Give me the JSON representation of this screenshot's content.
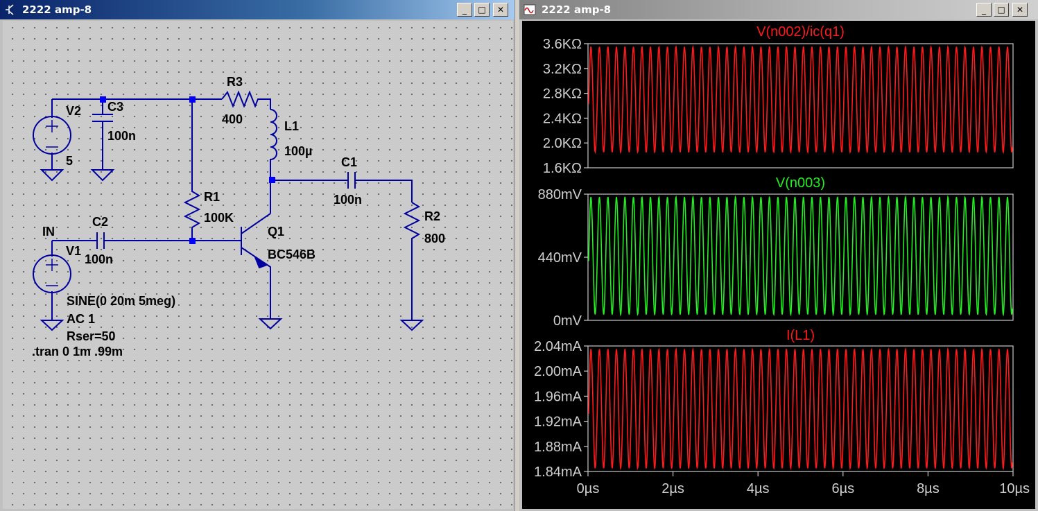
{
  "left_window": {
    "title": "2222 amp-8"
  },
  "right_window": {
    "title": "2222 amp-8"
  },
  "window_buttons": {
    "minimize": "_",
    "maximize": "□",
    "close": "✕"
  },
  "schematic": {
    "labels": {
      "v2_name": "V2",
      "v2_value": "5",
      "c3_name": "C3",
      "c3_value": "100n",
      "r3_name": "R3",
      "r3_value": "400",
      "l1_name": "L1",
      "l1_value": "100µ",
      "c1_name": "C1",
      "c1_value": "100n",
      "r1_name": "R1",
      "r1_value": "100K",
      "q1_name": "Q1",
      "q1_value": "BC546B",
      "r2_name": "R2",
      "r2_value": "800",
      "in_label": "IN",
      "c2_name": "C2",
      "c2_value": "100n",
      "v1_name": "V1",
      "v1_sine": "SINE(0 20m 5meg)",
      "v1_ac": "AC 1",
      "v1_rser": "Rser=50",
      "tran_directive": ".tran 0 1m .99m"
    }
  },
  "chart_data": [
    {
      "type": "line",
      "title": "V(n002)/ic(q1)",
      "color": "#ff1a1a",
      "y_ticks": [
        "3.6KΩ",
        "3.2KΩ",
        "2.8KΩ",
        "2.4KΩ",
        "2.0KΩ",
        "1.6KΩ"
      ],
      "ylim": [
        1600,
        3600
      ],
      "wave": {
        "min": 1850,
        "max": 3550,
        "period_us": 0.2
      },
      "xlim": [
        0,
        10
      ]
    },
    {
      "type": "line",
      "title": "V(n003)",
      "color": "#22ee22",
      "y_ticks": [
        "880mV",
        "440mV",
        "0mV"
      ],
      "ylim": [
        0,
        880
      ],
      "wave": {
        "min": 40,
        "max": 860,
        "period_us": 0.2
      },
      "xlim": [
        0,
        10
      ]
    },
    {
      "type": "line",
      "title": "I(L1)",
      "color": "#ff1a1a",
      "y_ticks": [
        "2.04mA",
        "2.00mA",
        "1.96mA",
        "1.92mA",
        "1.88mA",
        "1.84mA"
      ],
      "ylim": [
        1.84,
        2.04
      ],
      "wave": {
        "min": 1.845,
        "max": 2.035,
        "period_us": 0.2
      },
      "xlim": [
        0,
        10
      ],
      "x_ticks": [
        "0µs",
        "2µs",
        "4µs",
        "6µs",
        "8µs",
        "10µs"
      ]
    }
  ]
}
